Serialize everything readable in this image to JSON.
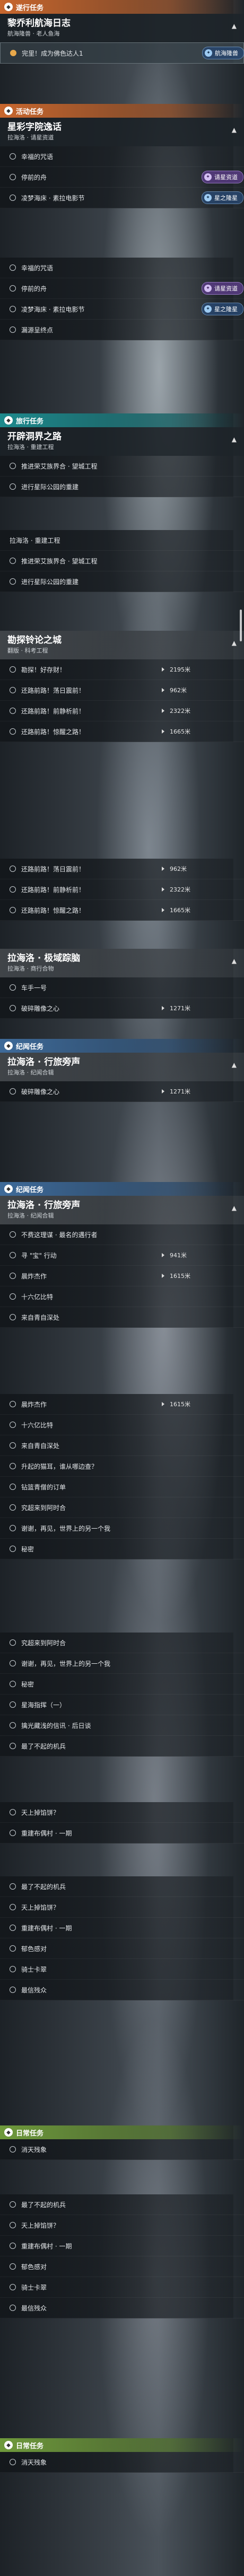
{
  "section_headers": {
    "following": "遂行任务",
    "activity": "活动任务",
    "travel": "旅行任务",
    "record": "纪闻任务",
    "daily": "日常任务"
  },
  "quest_titles": {
    "lighthouse": {
      "name": "黎乔利航海日志",
      "region": "航海隆兽 · 老人鱼海"
    },
    "star_fest": {
      "name": "星彩字院逸话",
      "region": "拉海洛 · 请星资道"
    },
    "open_world_a": {
      "name": "开辟洞界之路",
      "region": "拉海洛 · 重建工程"
    },
    "exploration": {
      "name": "勘探铃论之城",
      "region": "翻版 · 科考工程"
    },
    "caravan": {
      "name": "拉海洛 · 极域踪脑",
      "region": "拉海洛 · 商行合物"
    },
    "voyage_a": {
      "name": "拉海洛 · 行旅旁声",
      "region": "拉海洛 · 纪闻合辑"
    },
    "voyage_b": {
      "name": "拉海洛 · 行旅旁声",
      "region": "拉海洛 · 纪闻合辑"
    }
  },
  "objectives": {
    "lighthouse_1": "完里！成为佛色达人1",
    "star_1": "幸福的咒语",
    "star_2": "停前的舟",
    "star_3": "凌梦海床 · 素拉电影节",
    "star_4": "幸福的咒语",
    "star_5": "停前的舟",
    "star_6": "凌梦海床 · 素拉电影节",
    "star_7": "漏源呈终点",
    "open_1": "推进荣艾族界合 · 望城工程",
    "open_2": "进行星际公园的重建",
    "open_collapsed": "拉海洛 · 重建工程",
    "open_3": "推进荣艾族界合 · 望城工程",
    "open_4": "进行星际公园的重建",
    "exp_1": "勘探！好存财！",
    "exp_2": "还路前路！荡日震前！",
    "exp_3": "还路前路！前静析前！",
    "exp_4": "还路前路！惊醒之路！",
    "exp_5": "还路前路！荡日震前！",
    "exp_6": "还路前路！前静析前！",
    "exp_7": "还路前路！惊醒之路！",
    "caravan_1": "车手一号",
    "caravan_2": "破碎雕像之心",
    "caravan_3": "破碎雕像之心",
    "voy_1": "不费这理谋 · 最名的遇行者",
    "voy_2": "寻 \"宝\" 行动",
    "voy_3": "晨炸杰作",
    "voy_4": "十六亿比特",
    "voy_5": "来自青自深处",
    "voy_6": "晨炸杰作",
    "voy_7": "十六亿比特",
    "voy_8": "来自青自深处",
    "voy_9": "升起的猫耳，谁从哪边查？",
    "voy_10": "钻篮青僧的订单",
    "voy_11": "究超来到阿时合",
    "voy_12": "谢谢，再见，世界上的另一个我",
    "voy_13": "秘密",
    "voy_14": "究超来到阿时合",
    "voy_15": "谢谢，再见，世界上的另一个我",
    "voy_16": "秘密",
    "voy_17": "星海指挥（一）",
    "voy_18": "擒光藏浅的信讯 · 后日谈",
    "voy_19": "最了不起的机兵",
    "voy_20": "天上掉馅饼？",
    "voy_21": "重建布偶村 · 一期",
    "voy_22": "最了不起的机兵",
    "voy_23": "天上掉馅饼？",
    "voy_24": "重建布偶村 · 一期",
    "voy_25": "郁色感对",
    "voy_26": "骑士卡翠",
    "voy_27": "最信残众",
    "daily_1": "消天残象",
    "daily_2": "最了不起的机兵",
    "daily_3": "天上掉馅饼？",
    "daily_4": "重建布偶村 · 一期",
    "daily_5": "郁色感对",
    "daily_6": "骑士卡翠",
    "daily_7": "最信残众",
    "daily_8": "消天残象"
  },
  "distances": {
    "exp_1": "2195米",
    "exp_2": "962米",
    "exp_3": "2322米",
    "exp_4": "1665米",
    "exp_5": "962米",
    "exp_6": "2322米",
    "exp_7": "1665米",
    "caravan_2": "1271米",
    "caravan_3": "1271米",
    "voy_2": "941米",
    "voy_3": "1615米",
    "voy_6": "1615米"
  },
  "tags": {
    "navigate": "航海隆兽",
    "invite_1": "请星资道",
    "star_zone_1": "星之隆星",
    "invite_2": "请星资道",
    "star_zone_2": "星之隆星"
  },
  "icons": {
    "header": "compass-icon",
    "tag_a": "anchor-icon",
    "tag_b": "star-icon",
    "collapse": "chevron-icon"
  },
  "colors": {
    "following_header": "#c8672e",
    "travel_header": "#1e8a8d",
    "record_header": "#3e6a99",
    "daily_header": "#6f9a3c",
    "done_objective": "#e9a94b"
  }
}
